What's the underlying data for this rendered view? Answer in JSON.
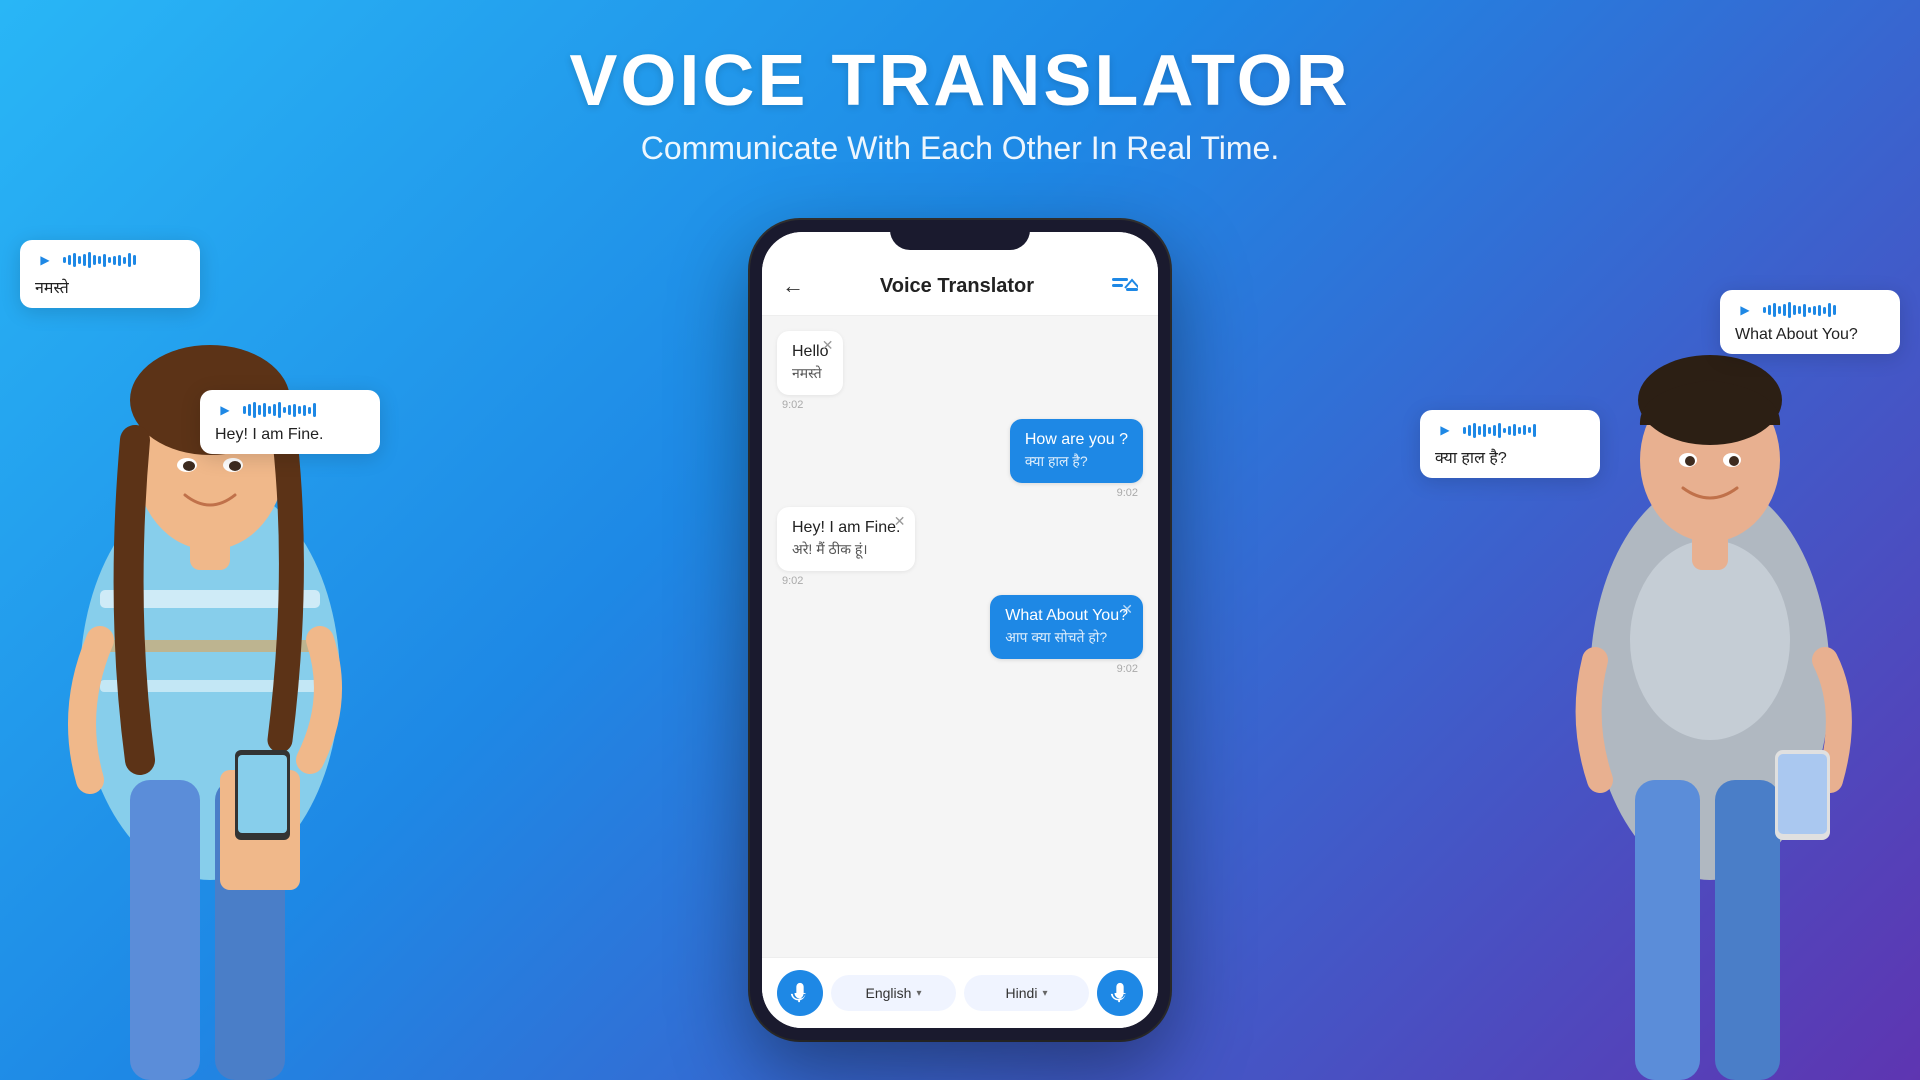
{
  "header": {
    "title": "VOICE TRANSLATOR",
    "subtitle": "Communicate With Each Other In Real Time."
  },
  "app": {
    "title": "Voice Translator",
    "back_label": "←",
    "messages": [
      {
        "id": "msg1",
        "side": "left",
        "primary": "Hello",
        "secondary": "नमस्ते",
        "timestamp": "9:02",
        "has_close": true
      },
      {
        "id": "msg2",
        "side": "right",
        "primary": "How are you ?",
        "secondary": "क्या हाल है?",
        "timestamp": "9:02",
        "has_close": false
      },
      {
        "id": "msg3",
        "side": "left",
        "primary": "Hey! I am Fine.",
        "secondary": "अरे! मैं ठीक हूं।",
        "timestamp": "9:02",
        "has_close": true
      },
      {
        "id": "msg4",
        "side": "right",
        "primary": "What About You?",
        "secondary": "आप क्या सोचते हो?",
        "timestamp": "9:02",
        "has_close": true
      }
    ],
    "bottom_bar": {
      "lang_left": "English",
      "lang_right": "Hindi"
    }
  },
  "float_bubbles": {
    "namaste": {
      "text": "नमस्ते",
      "position": "top-left"
    },
    "fine": {
      "text": "Hey! I am Fine.",
      "position": "mid-left"
    },
    "kaisa": {
      "text": "क्या हाल है?",
      "position": "mid-right"
    },
    "what_about": {
      "text": "What About You?",
      "position": "top-right"
    }
  },
  "icons": {
    "mic": "microphone-icon",
    "back": "back-arrow-icon",
    "translate": "translate-icon",
    "play": "play-icon",
    "close": "close-icon",
    "chevron_down": "chevron-down-icon"
  },
  "colors": {
    "primary": "#1e88e5",
    "background_start": "#29b6f6",
    "background_end": "#5e35b1",
    "bubble_right": "#1e88e5",
    "bubble_left": "#ffffff"
  }
}
